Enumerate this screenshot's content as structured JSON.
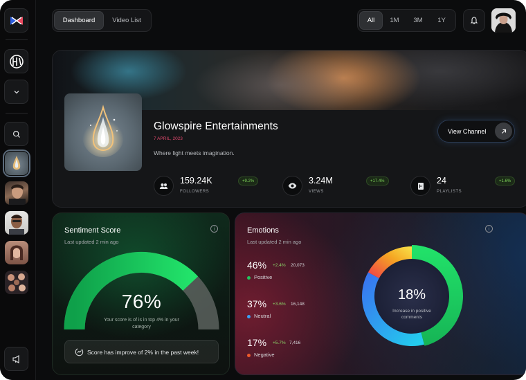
{
  "nav": {
    "tabs": [
      {
        "label": "Dashboard",
        "active": true
      },
      {
        "label": "Video List",
        "active": false
      }
    ],
    "periods": [
      {
        "label": "All",
        "active": true
      },
      {
        "label": "1M",
        "active": false
      },
      {
        "label": "3M",
        "active": false
      },
      {
        "label": "1Y",
        "active": false
      }
    ],
    "notification_icon": "bell-icon"
  },
  "sidebar": {
    "icons": [
      "app-logo-icon",
      "brand-mark-icon",
      "chevron-down-icon",
      "search-icon",
      "megaphone-icon"
    ],
    "channels": [
      "glowspire-thumbnail",
      "channel-avatar-1",
      "channel-avatar-2",
      "channel-avatar-3",
      "channel-group-avatar"
    ]
  },
  "channel": {
    "name": "Glowspire Entertainments",
    "date": "7 APRIL, 2023",
    "tagline": "Where light meets imagination.",
    "view_button": "View Channel",
    "date_color": "#e0486d",
    "stats": [
      {
        "value": "159.24K",
        "label": "FOLLOWERS",
        "change": "+9.2%",
        "icon": "users-icon"
      },
      {
        "value": "3.24M",
        "label": "VIEWS",
        "change": "+17.4%",
        "icon": "eye-icon"
      },
      {
        "value": "24",
        "label": "PLAYLISTS",
        "change": "+1.6%",
        "icon": "playlist-icon"
      }
    ]
  },
  "sentiment": {
    "title": "Sentiment Score",
    "updated": "Last updated 2 min ago",
    "score": 76,
    "score_label": "76%",
    "description": "Your score is of is in top 4% in your category",
    "improve_text": "Score has improve of 2% in the past week!",
    "accent": "#22e36a"
  },
  "emotions": {
    "title": "Emotions",
    "updated": "Last updated 2 min ago",
    "items": [
      {
        "percent": "46%",
        "change": "+2.4%",
        "count": "20,073",
        "label": "Positive",
        "color": "#22c55e"
      },
      {
        "percent": "37%",
        "change": "+3.6%",
        "count": "16,148",
        "label": "Neutral",
        "color": "#3aa0f5"
      },
      {
        "percent": "17%",
        "change": "+5.7%",
        "count": "7,416",
        "label": "Negative",
        "color": "#ef5a2a"
      }
    ],
    "center_value": "18%",
    "center_desc": "Increase in positive comments"
  }
}
